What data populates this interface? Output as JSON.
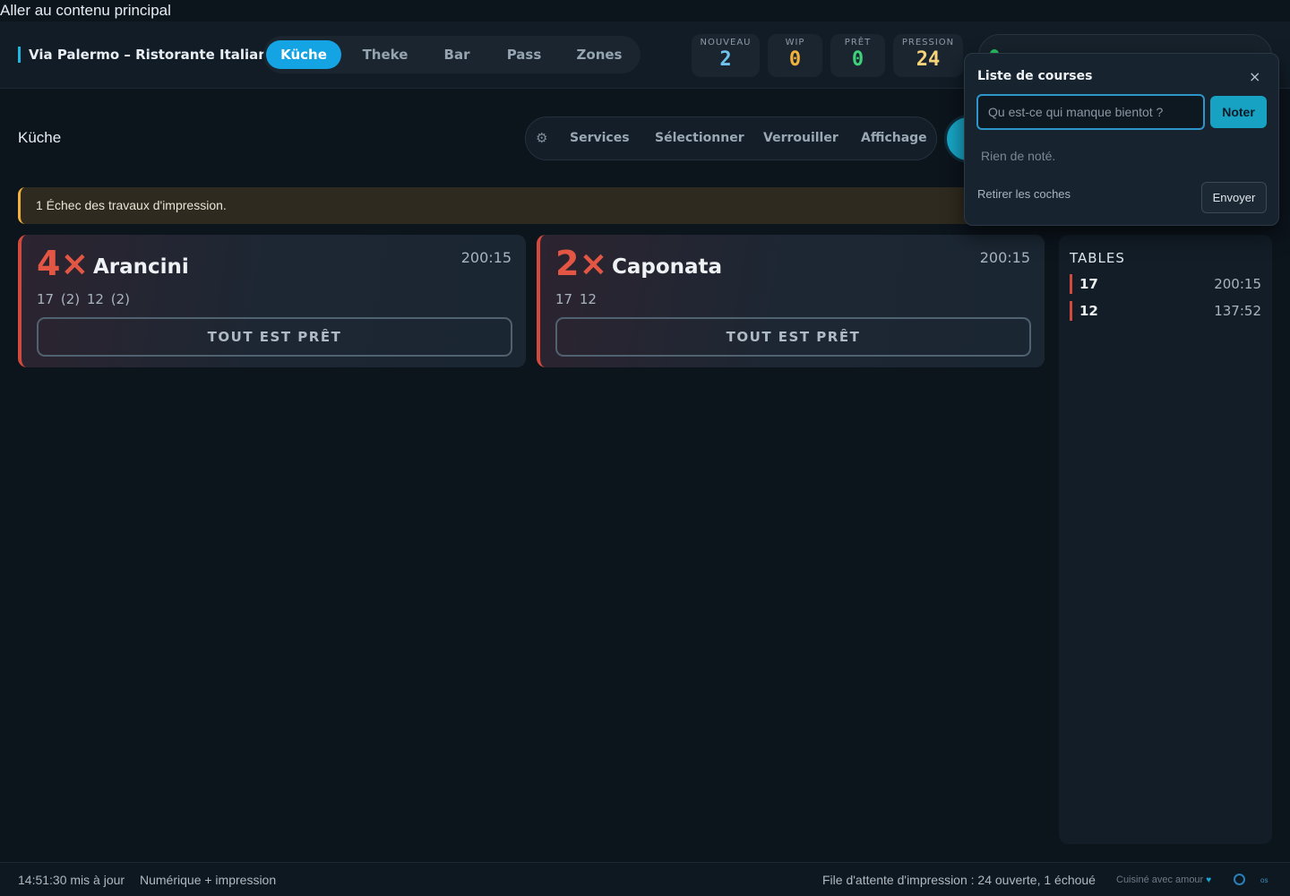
{
  "skip_link": "Aller au contenu principal",
  "header": {
    "brand": "Via Palermo – Ristorante Italiano",
    "tabs": [
      {
        "label": "Küche",
        "active": true
      },
      {
        "label": "Theke",
        "active": false
      },
      {
        "label": "Bar",
        "active": false
      },
      {
        "label": "Pass",
        "active": false
      },
      {
        "label": "Zones",
        "active": false
      }
    ],
    "stats": [
      {
        "label": "NOUVEAU",
        "value": "2",
        "color": "#6fc3ef"
      },
      {
        "label": "WIP",
        "value": "0",
        "color": "#f0b23c"
      },
      {
        "label": "PRÊT",
        "value": "0",
        "color": "#3fd07a"
      },
      {
        "label": "PRESSION",
        "value": "24",
        "color": "#f7d37a"
      }
    ],
    "status_dot_color": "#27c063"
  },
  "view": {
    "title": "Küche",
    "toolbar": {
      "settings_icon": "gear-icon",
      "services": "Services",
      "select": "Sélectionner",
      "lock": "Verrouiller",
      "display": "Affichage"
    }
  },
  "alert": {
    "text": "1 Échec des travaux d'impression.",
    "color": "#f0b23c"
  },
  "cards": [
    {
      "qty": "4×",
      "name": "Arancini",
      "time": "200:15",
      "tables": "17 (2)  12 (2)",
      "button": "TOUT EST PRÊT"
    },
    {
      "qty": "2×",
      "name": "Caponata",
      "time": "200:15",
      "tables": "17  12",
      "button": "TOUT EST PRÊT"
    }
  ],
  "tables_panel": {
    "title": "TABLES",
    "rows": [
      {
        "table": "17",
        "time": "200:15"
      },
      {
        "table": "12",
        "time": "137:52"
      }
    ]
  },
  "shopping_list": {
    "title": "Liste de courses",
    "close": "×",
    "input_placeholder": "Qu est-ce qui manque bientot ?",
    "note_button": "Noter",
    "empty_text": "Rien de noté.",
    "clear_checks": "Retirer les coches",
    "send_button": "Envoyer"
  },
  "footer": {
    "updated": "14:51:30 mis à jour",
    "mode": "Numérique + impression",
    "print_queue": "File d'attente d'impression : 24 ouverte, 1 échoué",
    "credit": "Cuisiné avec amour",
    "heart": "♥",
    "os": "os"
  }
}
